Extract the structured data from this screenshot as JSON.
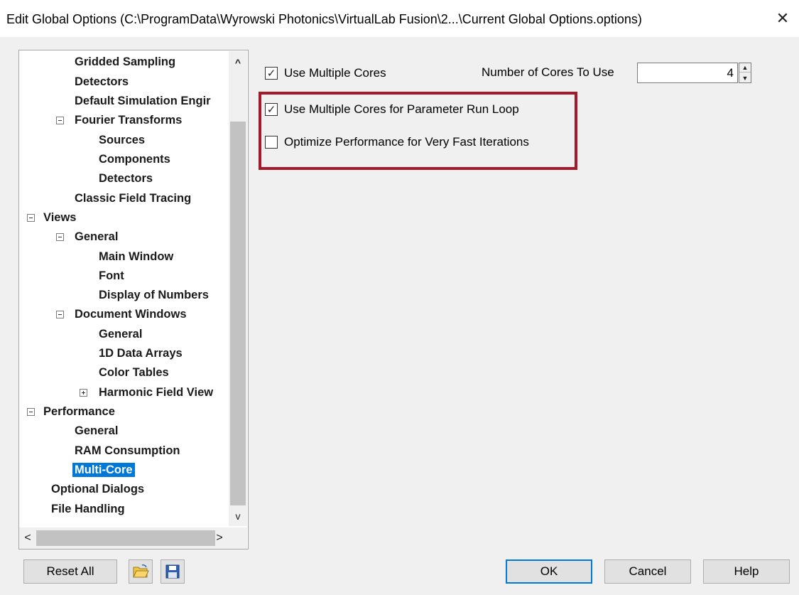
{
  "window": {
    "title": "Edit Global Options (C:\\ProgramData\\Wyrowski Photonics\\VirtualLab Fusion\\2...\\Current Global Options.options)",
    "close_glyph": "✕"
  },
  "tree": {
    "items": [
      {
        "label": "Gridded Sampling",
        "expander": null
      },
      {
        "label": "Detectors",
        "expander": null
      },
      {
        "label": "Default Simulation Engir",
        "expander": null
      },
      {
        "label": "Fourier Transforms",
        "expander": "minus"
      },
      {
        "label": "Sources",
        "expander": null
      },
      {
        "label": "Components",
        "expander": null
      },
      {
        "label": "Detectors",
        "expander": null
      },
      {
        "label": "Classic Field Tracing",
        "expander": null
      },
      {
        "label": "Views",
        "expander": "minus"
      },
      {
        "label": "General",
        "expander": "minus"
      },
      {
        "label": "Main Window",
        "expander": null
      },
      {
        "label": "Font",
        "expander": null
      },
      {
        "label": "Display of Numbers",
        "expander": null
      },
      {
        "label": "Document Windows",
        "expander": "minus"
      },
      {
        "label": "General",
        "expander": null
      },
      {
        "label": "1D Data Arrays",
        "expander": null
      },
      {
        "label": "Color Tables",
        "expander": null
      },
      {
        "label": "Harmonic Field View",
        "expander": "plus"
      },
      {
        "label": "Performance",
        "expander": "minus"
      },
      {
        "label": "General",
        "expander": null
      },
      {
        "label": "RAM Consumption",
        "expander": null
      },
      {
        "label": "Multi-Core",
        "expander": null,
        "selected": true
      },
      {
        "label": "Optional Dialogs",
        "expander": null
      },
      {
        "label": "File Handling",
        "expander": null
      }
    ],
    "scroll_up_glyph": "^",
    "scroll_down_glyph": "v",
    "scroll_left_glyph": "<",
    "scroll_right_glyph": ">"
  },
  "options": {
    "use_multiple_cores": {
      "label": "Use Multiple Cores",
      "checked": true
    },
    "cores_label": "Number of Cores To Use",
    "cores_value": "4",
    "param_run_loop": {
      "label": "Use Multiple Cores for Parameter Run Loop",
      "checked": true
    },
    "fast_iterations": {
      "label": "Optimize Performance for Very Fast Iterations",
      "checked": false
    }
  },
  "buttons": {
    "reset_all": "Reset All",
    "ok": "OK",
    "cancel": "Cancel",
    "help": "Help"
  },
  "icons": {
    "open": "open-folder-icon",
    "save": "save-disk-icon"
  },
  "colors": {
    "highlight_box": "#a51a2a",
    "selection": "#0078d7"
  }
}
